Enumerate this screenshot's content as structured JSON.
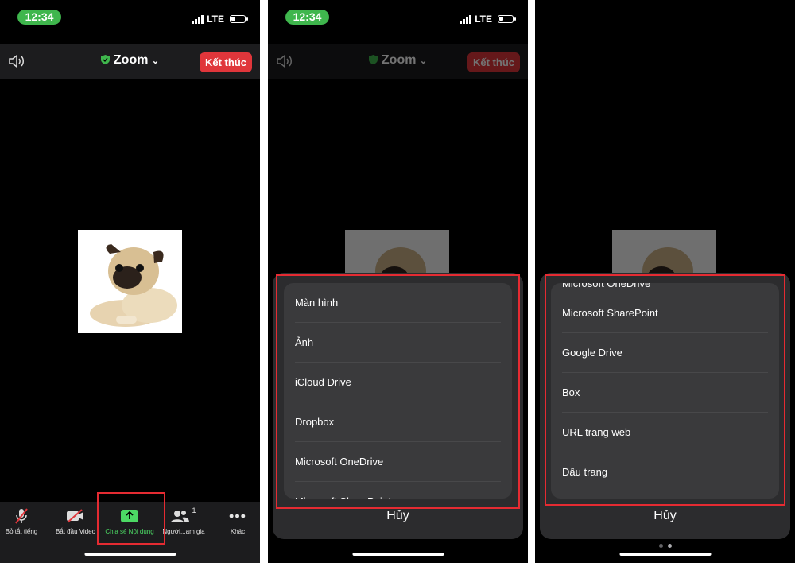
{
  "status": {
    "time": "12:34",
    "network": "LTE"
  },
  "header": {
    "title": "Zoom",
    "end_label": "Kết thúc"
  },
  "toolbar": {
    "mute": "Bỏ tắt tiếng",
    "video": "Bắt đầu Video",
    "share": "Chia sẻ Nội dung",
    "participants": "Người...am gia",
    "participants_count": "1",
    "more": "Khác"
  },
  "share_menu": {
    "page1": [
      "Màn hình",
      "Ảnh",
      "iCloud Drive",
      "Dropbox",
      "Microsoft OneDrive",
      "Microsoft SharePoint"
    ],
    "page2": [
      "Microsoft OneDrive",
      "Microsoft SharePoint",
      "Google Drive",
      "Box",
      "URL trang web",
      "Dấu trang"
    ],
    "cancel": "Hủy"
  },
  "colors": {
    "accent": "#3fb64d",
    "end": "#e0363b",
    "highlight": "#e52b32"
  }
}
